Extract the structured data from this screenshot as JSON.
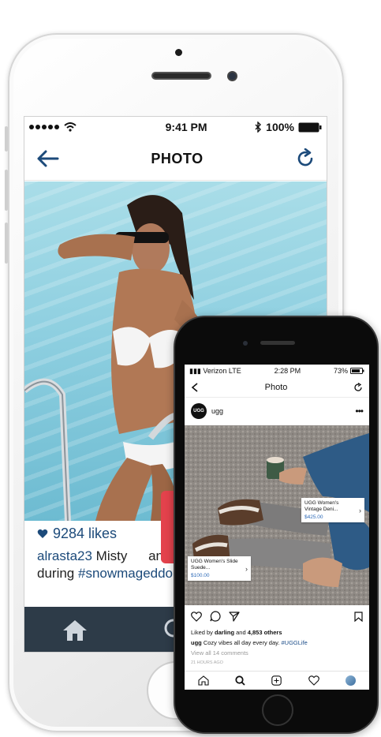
{
  "back_phone": {
    "status": {
      "time": "9:41 PM",
      "battery": "100%"
    },
    "nav": {
      "title": "PHOTO"
    },
    "post": {
      "likes": "9284 likes",
      "username": "alrasta23",
      "caption_part1": " Misty",
      "caption_part2": "an",
      "caption_line2_prefix": "during ",
      "hashtag": "#snowmageddo"
    }
  },
  "front_phone": {
    "status": {
      "carrier": "Verizon",
      "network": "LTE",
      "time": "2:28 PM",
      "battery": "73%"
    },
    "nav": {
      "title": "Photo"
    },
    "post": {
      "username": "ugg",
      "avatar_text": "UGG",
      "tags": [
        {
          "name": "UGG Women's Vintage Deni...",
          "price": "$425.00"
        },
        {
          "name": "UGG Women's Slide Suede...",
          "price": "$100.00"
        }
      ],
      "liked_by_prefix": "Liked by ",
      "liked_by_user": "darling",
      "liked_by_middle": " and ",
      "liked_by_count": "4,853 others",
      "caption_user": "ugg",
      "caption_text": " Cozy vibes all day every day. ",
      "caption_hashtag": "#UGGLife",
      "comments_link": "View all 14 comments",
      "timestamp": "21 HOURS AGO"
    }
  },
  "colors": {
    "accent_blue": "#1c4a7a",
    "tab_bar": "#2d3b48",
    "tab_active": "#1f5f9a",
    "tag_price": "#2d6ab7"
  }
}
